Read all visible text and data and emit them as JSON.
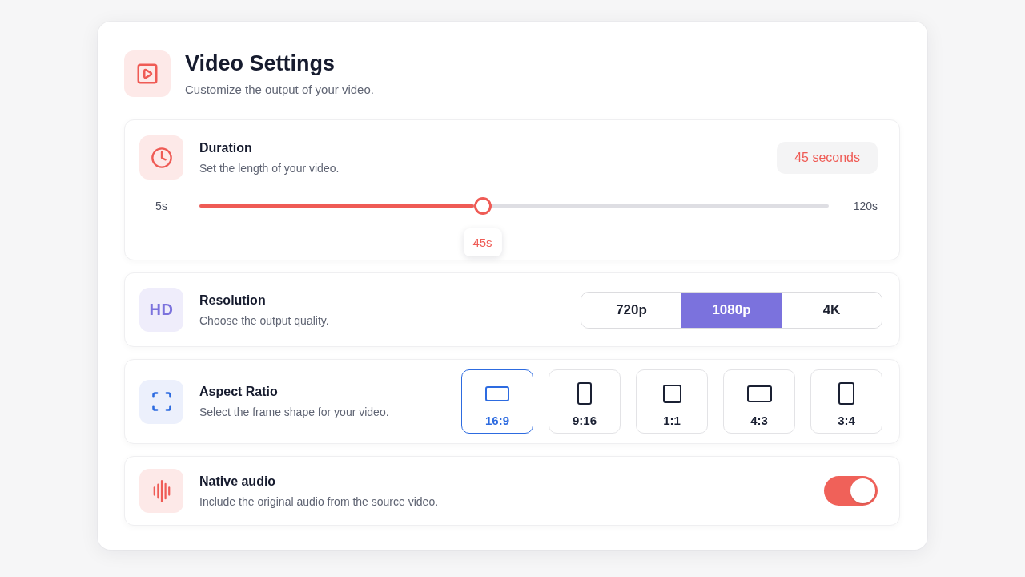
{
  "header": {
    "title": "Video Settings",
    "subtitle": "Customize the output of your video."
  },
  "sections": [
    {
      "kind": "slider",
      "title": "Duration",
      "description": "Set the length of your video.",
      "value_badge": "45 seconds",
      "min_label": "5s",
      "max_label": "120s",
      "level": 0.45,
      "tooltip": "45s"
    },
    {
      "kind": "segmented",
      "icon_text": "HD",
      "title": "Resolution",
      "description": "Choose the output quality.",
      "options": [
        {
          "label": "720p",
          "selected": false
        },
        {
          "label": "1080p",
          "selected": true
        },
        {
          "label": "4K",
          "selected": false
        }
      ]
    },
    {
      "kind": "shapes",
      "title": "Aspect Ratio",
      "description": "Select the frame shape for your video.",
      "options": [
        {
          "label": "16:9",
          "kind": "widescreen",
          "selected": true
        },
        {
          "label": "9:16",
          "kind": "vertical",
          "selected": false
        },
        {
          "label": "1:1",
          "kind": "square",
          "selected": false
        },
        {
          "label": "4:3",
          "kind": "landscape",
          "selected": false
        },
        {
          "label": "3:4",
          "kind": "portrait",
          "selected": false
        }
      ]
    },
    {
      "kind": "toggle",
      "title": "Native audio",
      "description": "Include the original audio from the source video.",
      "on": true
    }
  ]
}
